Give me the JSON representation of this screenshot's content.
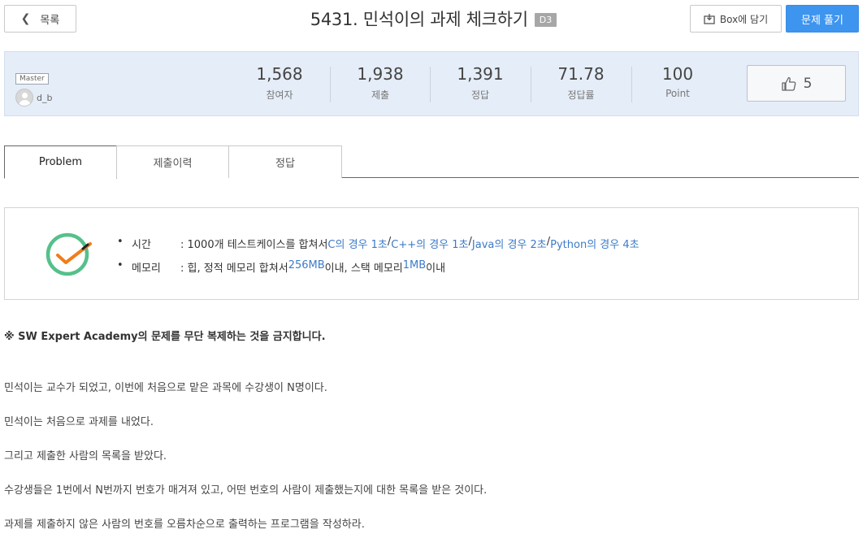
{
  "header": {
    "back_label": "목록",
    "title": "5431. 민석이의 과제 체크하기",
    "level": "D3",
    "box_label": "Box에 담기",
    "solve_label": "문제 풀기"
  },
  "author": {
    "badge": "Master",
    "name": "d_b"
  },
  "stats": [
    {
      "value": "1,568",
      "label": "참여자"
    },
    {
      "value": "1,938",
      "label": "제출"
    },
    {
      "value": "1,391",
      "label": "정답"
    },
    {
      "value": "71.78",
      "label": "정답률"
    },
    {
      "value": "100",
      "label": "Point"
    }
  ],
  "likes": "5",
  "tabs": [
    {
      "label": "Problem"
    },
    {
      "label": "제출이력"
    },
    {
      "label": "정답"
    }
  ],
  "limits": {
    "time": {
      "key": "시간",
      "prefix": ": 1000개 테스트케이스를 합쳐서 ",
      "c": "C의 경우 1초",
      "sep": " / ",
      "cpp": "C++의 경우 1초",
      "java": "Java의 경우 2초",
      "python": "Python의 경우 4초"
    },
    "memory": {
      "key": "메모리",
      "prefix": ": 힙, 정적 메모리 합쳐서 ",
      "heap": "256MB",
      "middle": " 이내, 스택 메모리 ",
      "stack": "1MB",
      "suffix": " 이내"
    }
  },
  "description": {
    "warning": "※ SW Expert Academy의 문제를 무단 복제하는 것을 금지합니다.",
    "paragraphs": [
      "민석이는 교수가 되었고, 이번에 처음으로 맡은 과목에 수강생이 N명이다.",
      "민석이는 처음으로 과제를 내었다.",
      "그리고 제출한 사람의 목록을 받았다.",
      "수강생들은 1번에서 N번까지 번호가 매겨져 있고, 어떤 번호의 사람이 제출했는지에 대한 목록을 받은 것이다.",
      "과제를 제출하지 않은 사람의 번호를 오름차순으로 출력하는 프로그램을 작성하라."
    ]
  },
  "colors": {
    "accent": "#3d95ef",
    "panel": "#e5edf8",
    "link": "#3d7bc8",
    "clock_ring": "#56c08b",
    "clock_hand": "#f07d1a"
  }
}
